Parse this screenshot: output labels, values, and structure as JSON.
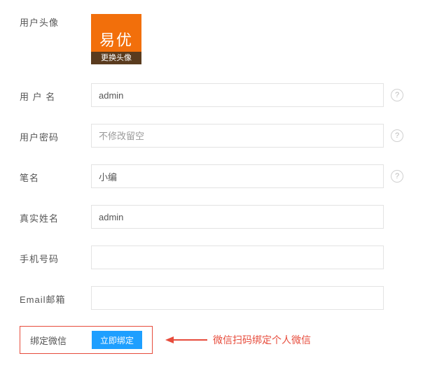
{
  "avatar": {
    "label": "用户头像",
    "logo_text": "易优",
    "change_text": "更换头像"
  },
  "username": {
    "label": "用 户 名",
    "value": "admin"
  },
  "password": {
    "label": "用户密码",
    "placeholder": "不修改留空"
  },
  "penname": {
    "label": "笔名",
    "value": "小编"
  },
  "realname": {
    "label": "真实姓名",
    "value": "admin"
  },
  "phone": {
    "label": "手机号码",
    "value": ""
  },
  "email": {
    "label": "Email邮箱",
    "value": ""
  },
  "bind": {
    "label": "绑定微信",
    "button": "立即绑定",
    "note": "微信扫码绑定个人微信"
  },
  "help_char": "?"
}
